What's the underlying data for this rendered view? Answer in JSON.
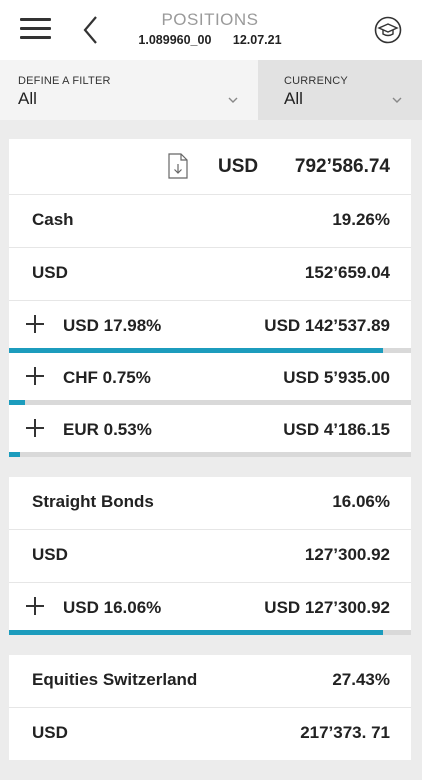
{
  "header": {
    "title": "POSITIONS",
    "account": "1.089960_00",
    "date": "12.07.21"
  },
  "filters": {
    "left": {
      "label": "DEFINE A FILTER",
      "value": "All"
    },
    "right": {
      "label": "CURRENCY",
      "value": "All"
    }
  },
  "total": {
    "currency": "USD",
    "amount": "792’586.74"
  },
  "sections": [
    {
      "name": "Cash",
      "pct": "19.26%",
      "currency": "USD",
      "amount": "152’659.04",
      "items": [
        {
          "label": "USD  17.98%",
          "value": "USD 142’537.89",
          "share": 0.9303
        },
        {
          "label": "CHF  0.75%",
          "value": "USD 5’935.00",
          "share": 0.0389
        },
        {
          "label": "EUR  0.53%",
          "value": "USD 4’186.15",
          "share": 0.0275
        }
      ]
    },
    {
      "name": "Straight Bonds",
      "pct": "16.06%",
      "currency": "USD",
      "amount": "127’300.92",
      "items": [
        {
          "label": "USD  16.06%",
          "value": "USD 127’300.92",
          "share": 0.9303
        }
      ]
    },
    {
      "name": "Equities Switzerland",
      "pct": "27.43%",
      "currency": "USD",
      "amount": "217’373. 71",
      "items": []
    }
  ],
  "icons": {
    "menu": "hamburger-icon",
    "back": "chevron-left-icon",
    "profile": "mortarboard-icon",
    "download": "download-file-icon",
    "expand": "plus-icon"
  },
  "colors": {
    "accent": "#1c9cbd",
    "track": "#d9d9d9"
  }
}
